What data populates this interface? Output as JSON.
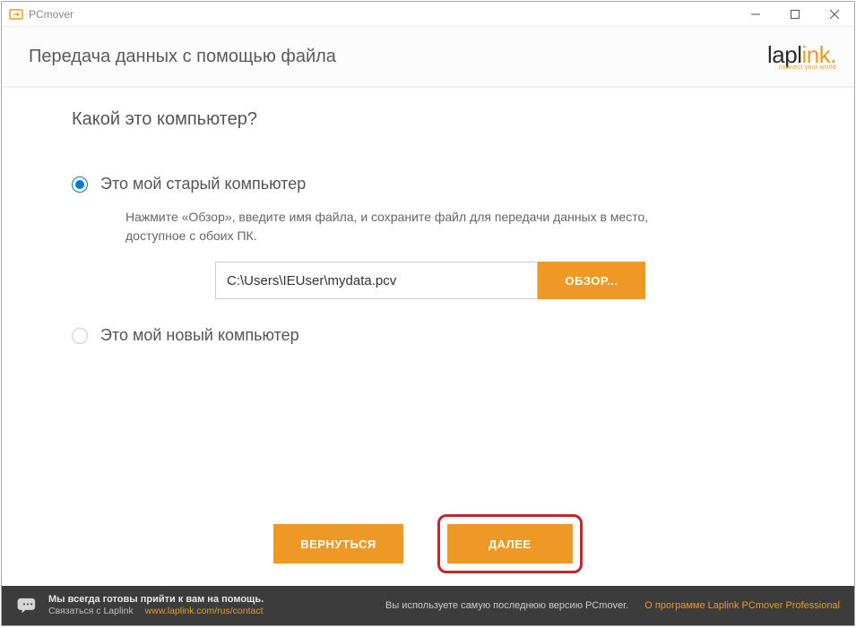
{
  "titlebar": {
    "app_name": "PCmover"
  },
  "header": {
    "page_title": "Передача данных с помощью файла"
  },
  "logo": {
    "brand_left": "lapl",
    "brand_right": "ink",
    "dot": ".",
    "tagline": "connect your world"
  },
  "content": {
    "question": "Какой это компьютер?",
    "option_old": {
      "label": "Это мой старый компьютер",
      "desc": "Нажмите «Обзор», введите имя файла, и сохраните файл для передачи данных в место, доступное с обоих ПК.",
      "path_value": "C:\\Users\\IEUser\\mydata.pcv",
      "browse_label": "ОБЗОР..."
    },
    "option_new": {
      "label": "Это мой новый компьютер"
    }
  },
  "nav": {
    "back_label": "ВЕРНУТЬСЯ",
    "next_label": "ДАЛЕЕ"
  },
  "footer": {
    "help_bold": "Мы всегда готовы прийти к вам на помощь.",
    "help_sub": "Связаться с Laplink",
    "help_link": "www.laplink.com/rus/contact",
    "version_text": "Вы используете самую последнюю версию PCmover.",
    "about_link": "О программе Laplink PCmover Professional"
  }
}
